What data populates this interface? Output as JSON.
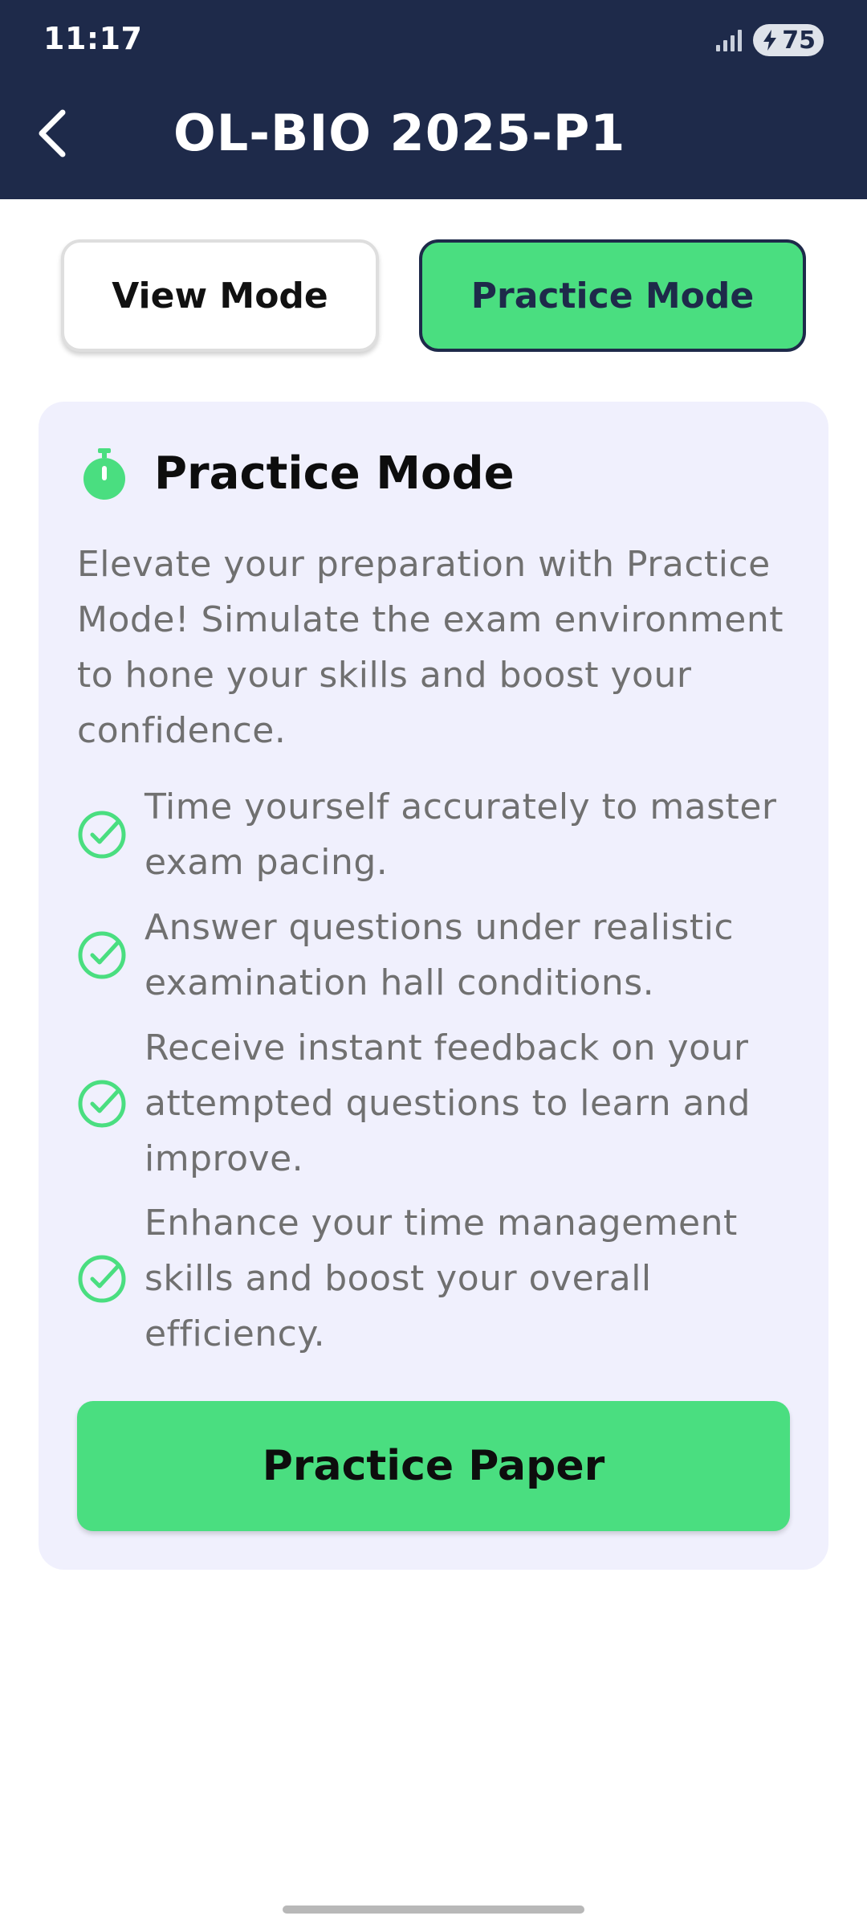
{
  "status_bar": {
    "time": "11:17",
    "battery_level": "75",
    "signal_icon": "signal-bars-icon",
    "battery_icon": "battery-charging-icon"
  },
  "header": {
    "title": "OL-BIO 2025-P1",
    "back_icon": "chevron-left-icon"
  },
  "mode_toggle": {
    "view_label": "View Mode",
    "practice_label": "Practice Mode",
    "selected": "Practice Mode"
  },
  "card": {
    "icon": "stopwatch-icon",
    "title": "Practice Mode",
    "description": "Elevate your preparation with Practice Mode! Simulate the exam environment to hone your skills and boost your confidence.",
    "features": [
      "Time yourself accurately to master exam pacing.",
      "Answer questions under realistic examination hall conditions.",
      "Receive instant feedback on your attempted questions to learn and improve.",
      "Enhance your time management skills and boost your overall efficiency."
    ],
    "feature_icon": "check-circle-icon",
    "button_label": "Practice Paper"
  },
  "colors": {
    "header_bg": "#1e2a4a",
    "accent_green": "#4ade80",
    "card_bg": "#f0f0fd",
    "body_text": "#707070"
  }
}
